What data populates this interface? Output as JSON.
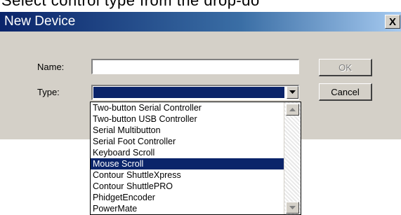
{
  "background_text": "Select control type from the drop-do",
  "dialog": {
    "title": "New Device",
    "close_glyph": "X",
    "name_label": "Name:",
    "name_value": "",
    "type_label": "Type:",
    "type_selected": "",
    "ok_label": "OK",
    "cancel_label": "Cancel"
  },
  "dropdown": {
    "items": [
      "Two-button Serial Controller",
      "Two-button USB Controller",
      "Serial Multibutton",
      "Serial Foot Controller",
      "Keyboard Scroll",
      "Mouse Scroll",
      "Contour ShuttleXpress",
      "Contour ShuttlePRO",
      "PhidgetEncoder",
      "PowerMate"
    ],
    "highlighted": "Mouse Scroll"
  },
  "colors": {
    "titlebar_start": "#0a246a",
    "titlebar_end": "#a6caf0",
    "selection": "#0a246a",
    "face": "#d4d0c8"
  },
  "icons": {
    "dropdown_arrow": "chevron-down-icon",
    "scroll_up": "scroll-up-arrow-icon",
    "scroll_down": "scroll-down-arrow-icon",
    "close": "close-icon"
  }
}
